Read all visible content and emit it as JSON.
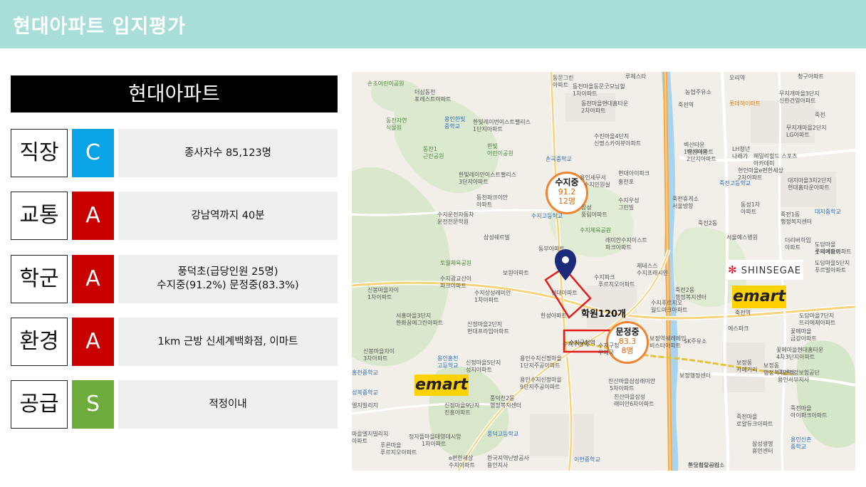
{
  "page": {
    "title": "현대아파트 입지평가"
  },
  "subject": {
    "name": "현대아파트"
  },
  "grade_colors": {
    "C": "#0aa3e6",
    "A": "#c80000",
    "S": "#6dab3c"
  },
  "rows": [
    {
      "category": "직장",
      "grade": "C",
      "lines": [
        "종사자수 85,123명"
      ]
    },
    {
      "category": "교통",
      "grade": "A",
      "lines": [
        "강남역까지 40분"
      ]
    },
    {
      "category": "학군",
      "grade": "A",
      "lines": [
        "풍덕초(급당인원 25명)",
        "수지중(91.2%) 문정중(83.3%)"
      ]
    },
    {
      "category": "환경",
      "grade": "A",
      "lines": [
        "1km 근방 신세계백화점, 이마트"
      ]
    },
    {
      "category": "공급",
      "grade": "S",
      "lines": [
        "적정이내"
      ]
    }
  ],
  "map": {
    "schools": [
      {
        "name": "수지중",
        "score": "91.2",
        "count": "12명"
      },
      {
        "name": "문정중",
        "score": "83.3",
        "count": "8명"
      }
    ],
    "academy_label": "학원120개",
    "station_label": "수지구청역",
    "apartment_label": "현대아파트",
    "brands": {
      "emart": "emart",
      "shinsegae": "SHINSEGAE"
    },
    "labels": [
      {
        "t": "손초어린이공원",
        "c": "green"
      },
      {
        "t": "더샵동천",
        "c": ""
      },
      {
        "t": "포레스트아파트",
        "c": ""
      },
      {
        "t": "동천자연",
        "c": "green"
      },
      {
        "t": "식물원",
        "c": "green"
      },
      {
        "t": "용인한빛",
        "c": "blue"
      },
      {
        "t": "중학교",
        "c": "blue"
      },
      {
        "t": "한빛레이번이스트팰리스",
        "c": ""
      },
      {
        "t": "1단지아파트",
        "c": ""
      },
      {
        "t": "한빛",
        "c": "green"
      },
      {
        "t": "어린이공원",
        "c": "green"
      },
      {
        "t": "동천1",
        "c": "green"
      },
      {
        "t": "근린공원",
        "c": "green"
      },
      {
        "t": "한빛레이안이스트팰리스",
        "c": ""
      },
      {
        "t": "3단지아파트",
        "c": ""
      },
      {
        "t": "동천파크이안",
        "c": ""
      },
      {
        "t": "아파트",
        "c": ""
      },
      {
        "t": "수지운전자동차",
        "c": ""
      },
      {
        "t": "운전전문학원",
        "c": ""
      },
      {
        "t": "삼성쉐르빌",
        "c": ""
      },
      {
        "t": "토월체육공원",
        "c": "green"
      },
      {
        "t": "수지광교산이",
        "c": ""
      },
      {
        "t": "파크아파트",
        "c": ""
      },
      {
        "t": "신봉마을자이",
        "c": ""
      },
      {
        "t": "1차아파트",
        "c": ""
      },
      {
        "t": "서홍마을3단지",
        "c": ""
      },
      {
        "t": "한화꿈에그린아파트",
        "c": ""
      },
      {
        "t": "신봉마을자이",
        "c": ""
      },
      {
        "t": "3차아파트",
        "c": ""
      },
      {
        "t": "용인홍천",
        "c": "blue"
      },
      {
        "t": "고등학교",
        "c": "blue"
      },
      {
        "t": "홍천중학교",
        "c": "blue"
      },
      {
        "t": "성복중학교",
        "c": "blue"
      },
      {
        "t": "엘지빌리지",
        "c": ""
      },
      {
        "t": "마을엘지빌리지",
        "c": ""
      },
      {
        "t": "아파트",
        "c": ""
      },
      {
        "t": "정자뜰마을태영데시앙",
        "c": ""
      },
      {
        "t": "1차아파트",
        "c": ""
      },
      {
        "t": "푸른마을",
        "c": ""
      },
      {
        "t": "푸르지오아파트",
        "c": ""
      },
      {
        "t": "e편한세상",
        "c": ""
      },
      {
        "t": "수지아파트",
        "c": ""
      },
      {
        "t": "풍덕천2동",
        "c": ""
      },
      {
        "t": "행정복지센터",
        "c": ""
      },
      {
        "t": "신정마을9단지",
        "c": ""
      },
      {
        "t": "진흥아파트",
        "c": ""
      },
      {
        "t": "풍덕고등학교",
        "c": "blue"
      },
      {
        "t": "한국지역난방공사",
        "c": ""
      },
      {
        "t": "용인지사",
        "c": ""
      },
      {
        "t": "이현중학교",
        "c": "blue"
      },
      {
        "t": "진산마을삼성래미안",
        "c": ""
      },
      {
        "t": "5차아파트",
        "c": ""
      },
      {
        "t": "진산마을삼성",
        "c": ""
      },
      {
        "t": "래미안6차아파트",
        "c": ""
      },
      {
        "t": "용인수지신정마을",
        "c": ""
      },
      {
        "t": "9단지주공아파트",
        "c": ""
      },
      {
        "t": "용인수지신정마을",
        "c": ""
      },
      {
        "t": "1단지주공아파트",
        "c": ""
      },
      {
        "t": "신정마을5단지",
        "c": ""
      },
      {
        "t": "성지아파트",
        "c": ""
      },
      {
        "t": "신정마을2단지",
        "c": ""
      },
      {
        "t": "현대프라임아파트",
        "c": ""
      },
      {
        "t": "한성아파트",
        "c": ""
      },
      {
        "t": "수지상성레미안",
        "c": ""
      },
      {
        "t": "1차아파트",
        "c": ""
      },
      {
        "t": "보원아파트",
        "c": ""
      },
      {
        "t": "동부아파트",
        "c": ""
      },
      {
        "t": "수지체육공원",
        "c": "green"
      },
      {
        "t": "래미안수지이스트",
        "c": ""
      },
      {
        "t": "파크아파트",
        "c": ""
      },
      {
        "t": "제네스스",
        "c": ""
      },
      {
        "t": "수지프레시안",
        "c": ""
      },
      {
        "t": "수지파크",
        "c": ""
      },
      {
        "t": "푸르지오아파트",
        "c": ""
      },
      {
        "t": "동문그린",
        "c": ""
      },
      {
        "t": "아파트",
        "c": ""
      },
      {
        "t": "동천마을동문굿모닝힐",
        "c": ""
      },
      {
        "t": "1차아파트",
        "c": ""
      },
      {
        "t": "동천마을현대홈타운",
        "c": ""
      },
      {
        "t": "2차아파트",
        "c": ""
      },
      {
        "t": "수진마을4단지",
        "c": ""
      },
      {
        "t": "신명스카이뷰아파트",
        "c": ""
      },
      {
        "t": "손곡중학교",
        "c": "blue"
      },
      {
        "t": "현대아이파크",
        "c": ""
      },
      {
        "t": "홍천포",
        "c": ""
      },
      {
        "t": "용인세무서",
        "c": ""
      },
      {
        "t": "수지민원실",
        "c": ""
      },
      {
        "t": "수지우성",
        "c": ""
      },
      {
        "t": "그린빌",
        "c": ""
      },
      {
        "t": "수지고등학교",
        "c": "blue"
      },
      {
        "t": "삼성",
        "c": ""
      },
      {
        "t": "풍림아파트",
        "c": ""
      },
      {
        "t": "루체스타",
        "c": ""
      },
      {
        "t": "벽산타운",
        "c": ""
      },
      {
        "t": "1단지아파트",
        "c": ""
      },
      {
        "t": "벽산타운",
        "c": ""
      },
      {
        "t": "2단지아파트",
        "c": ""
      },
      {
        "t": "LH청년",
        "c": ""
      },
      {
        "t": "나래가",
        "c": ""
      },
      {
        "t": "죽전휴게소",
        "c": ""
      },
      {
        "t": "서울방향",
        "c": ""
      },
      {
        "t": "죽전2동",
        "c": ""
      },
      {
        "t": "죽전고등학교",
        "c": "blue"
      },
      {
        "t": "현인마을e편한세상",
        "c": ""
      },
      {
        "t": "2차아파트",
        "c": ""
      },
      {
        "t": "동성1차",
        "c": ""
      },
      {
        "t": "아파트",
        "c": ""
      },
      {
        "t": "서울예스병원",
        "c": ""
      },
      {
        "t": "농협주유소",
        "c": ""
      },
      {
        "t": "오리역",
        "c": ""
      },
      {
        "t": "롯데하이마트",
        "c": "orange"
      },
      {
        "t": "죽전역",
        "c": ""
      },
      {
        "t": "죽전2동",
        "c": ""
      },
      {
        "t": "행정복지센터",
        "c": ""
      },
      {
        "t": "수지구청역",
        "c": ""
      },
      {
        "t": "죽전역",
        "c": ""
      },
      {
        "t": "에스파크",
        "c": ""
      },
      {
        "t": "수지푸르지오",
        "c": ""
      },
      {
        "t": "월드마크아파트",
        "c": ""
      },
      {
        "t": "SK주유소",
        "c": ""
      },
      {
        "t": "보정동",
        "c": ""
      },
      {
        "t": "카페거리",
        "c": ""
      },
      {
        "t": "보정동",
        "c": ""
      },
      {
        "t": "행정복지센터",
        "c": ""
      },
      {
        "t": "보정역쉐레메인",
        "c": ""
      },
      {
        "t": "비스타아파트",
        "c": ""
      },
      {
        "t": "수지구청",
        "c": ""
      },
      {
        "t": "우체국",
        "c": ""
      },
      {
        "t": "보정행정센터",
        "c": ""
      },
      {
        "t": "죽전마을",
        "c": ""
      },
      {
        "t": "로얄듀크아파트",
        "c": ""
      },
      {
        "t": "삼성생명",
        "c": ""
      },
      {
        "t": "휴먼센터",
        "c": ""
      },
      {
        "t": "한국철도공사",
        "c": ""
      },
      {
        "t": "분당차량사업소",
        "c": ""
      },
      {
        "t": "청구아파트",
        "c": ""
      },
      {
        "t": "무지개마을3단지",
        "c": ""
      },
      {
        "t": "신한건영아파트",
        "c": ""
      },
      {
        "t": "무지개마을2단지",
        "c": ""
      },
      {
        "t": "LG아파트",
        "c": ""
      },
      {
        "t": "헤밀리힐드 스포츠",
        "c": ""
      },
      {
        "t": "아카데미",
        "c": ""
      },
      {
        "t": "대지마을3차2단지",
        "c": ""
      },
      {
        "t": "현대홈타운아파트",
        "c": ""
      },
      {
        "t": "대지중학교",
        "c": "blue"
      },
      {
        "t": "죽전1동",
        "c": ""
      },
      {
        "t": "행정복지센터",
        "c": ""
      },
      {
        "t": "더리버하임",
        "c": ""
      },
      {
        "t": "아파트",
        "c": ""
      },
      {
        "t": "도담마을",
        "c": ""
      },
      {
        "t": "롯데캐슬아파트",
        "c": ""
      },
      {
        "t": "도담마을5단지",
        "c": ""
      },
      {
        "t": "푸르빌아파트",
        "c": ""
      },
      {
        "t": "도담마을7단지",
        "c": ""
      },
      {
        "t": "뜨리에체아파트",
        "c": ""
      },
      {
        "t": "꽃메마을",
        "c": ""
      },
      {
        "t": "금강아파트",
        "c": ""
      },
      {
        "t": "꽃메마을현대홈타운",
        "c": ""
      },
      {
        "t": "4차3단지아파트",
        "c": ""
      },
      {
        "t": "국민건강보험공단",
        "c": ""
      },
      {
        "t": "용인서부지사",
        "c": ""
      },
      {
        "t": "죽전마을",
        "c": ""
      },
      {
        "t": "아이파크아파트",
        "c": ""
      },
      {
        "t": "용인신촌",
        "c": "blue"
      },
      {
        "t": "중학교",
        "c": "blue"
      },
      {
        "t": "수지아파트",
        "c": ""
      },
      {
        "t": "죽전",
        "c": ""
      }
    ]
  }
}
